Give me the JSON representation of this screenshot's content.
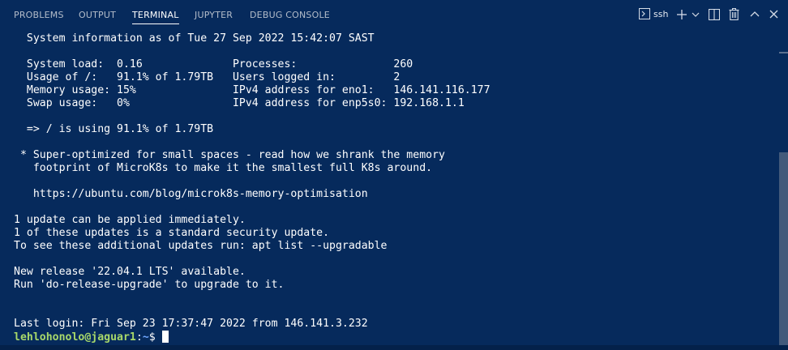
{
  "tabs": [
    {
      "label": "PROBLEMS"
    },
    {
      "label": "OUTPUT"
    },
    {
      "label": "TERMINAL",
      "active": true
    },
    {
      "label": "JUPYTER"
    },
    {
      "label": "DEBUG CONSOLE"
    }
  ],
  "actions": {
    "terminal_profile_label": "ssh",
    "icons": [
      "terminal-icon",
      "add-icon",
      "chevron-down-icon",
      "split-icon",
      "trash-icon",
      "maximize-icon",
      "close-icon"
    ]
  },
  "terminal": {
    "lines": [
      "  System information as of Tue 27 Sep 2022 15:42:07 SAST",
      "",
      "  System load:  0.16              Processes:               260",
      "  Usage of /:   91.1% of 1.79TB   Users logged in:         2",
      "  Memory usage: 15%               IPv4 address for eno1:   146.141.116.177",
      "  Swap usage:   0%                IPv4 address for enp5s0: 192.168.1.1",
      "",
      "  => / is using 91.1% of 1.79TB",
      "",
      " * Super-optimized for small spaces - read how we shrank the memory",
      "   footprint of MicroK8s to make it the smallest full K8s around.",
      "",
      "   https://ubuntu.com/blog/microk8s-memory-optimisation",
      "",
      "1 update can be applied immediately.",
      "1 of these updates is a standard security update.",
      "To see these additional updates run: apt list --upgradable",
      "",
      "New release '22.04.1 LTS' available.",
      "Run 'do-release-upgrade' to upgrade to it.",
      "",
      "",
      "Last login: Fri Sep 23 17:37:47 2022 from 146.141.3.232"
    ],
    "prompt": {
      "user_host": "lehlohonolo@jaguar1",
      "separator": ":",
      "path": "~",
      "symbol": "$ "
    }
  },
  "colors": {
    "background": "#062a5c",
    "text": "#ffffff",
    "prompt_user": "#a8d86a",
    "prompt_path": "#6fa7ff",
    "scroll_thumb": "#435a7b"
  }
}
